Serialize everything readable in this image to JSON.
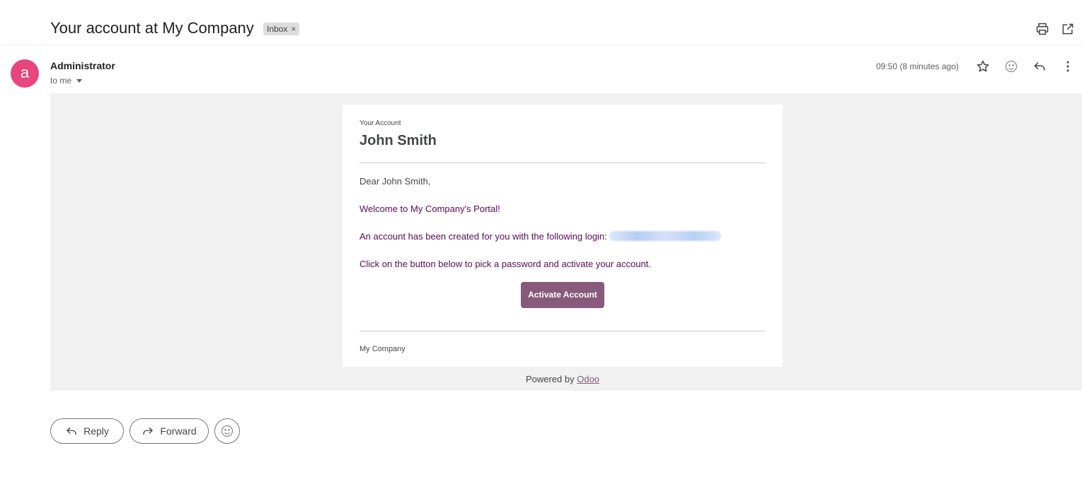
{
  "header": {
    "subject": "Your account at My Company",
    "label": "Inbox",
    "label_remove": "×"
  },
  "message": {
    "avatar_letter": "a",
    "avatar_color": "#e8467c",
    "sender": "Administrator",
    "recipient": "to me",
    "time": "09:50 (8 minutes ago)"
  },
  "email": {
    "section_label": "Your Account",
    "name": "John Smith",
    "greeting": "Dear John Smith,",
    "welcome": "Welcome to My Company's Portal!",
    "created_text": "An account has been created for you with the following login:",
    "instruction": "Click on the button below to pick a password and activate your account.",
    "activate_label": "Activate Account",
    "company": "My Company",
    "powered_prefix": "Powered by",
    "powered_link": "Odoo",
    "accent_color": "#875a7b",
    "text_color": "#570a57"
  },
  "actions": {
    "reply_label": "Reply",
    "forward_label": "Forward"
  },
  "icons": {
    "print": "print-icon",
    "open": "open-in-new-window-icon",
    "star": "star-icon",
    "emoji": "emoji-icon",
    "reply": "reply-icon",
    "more": "more-vert-icon"
  }
}
